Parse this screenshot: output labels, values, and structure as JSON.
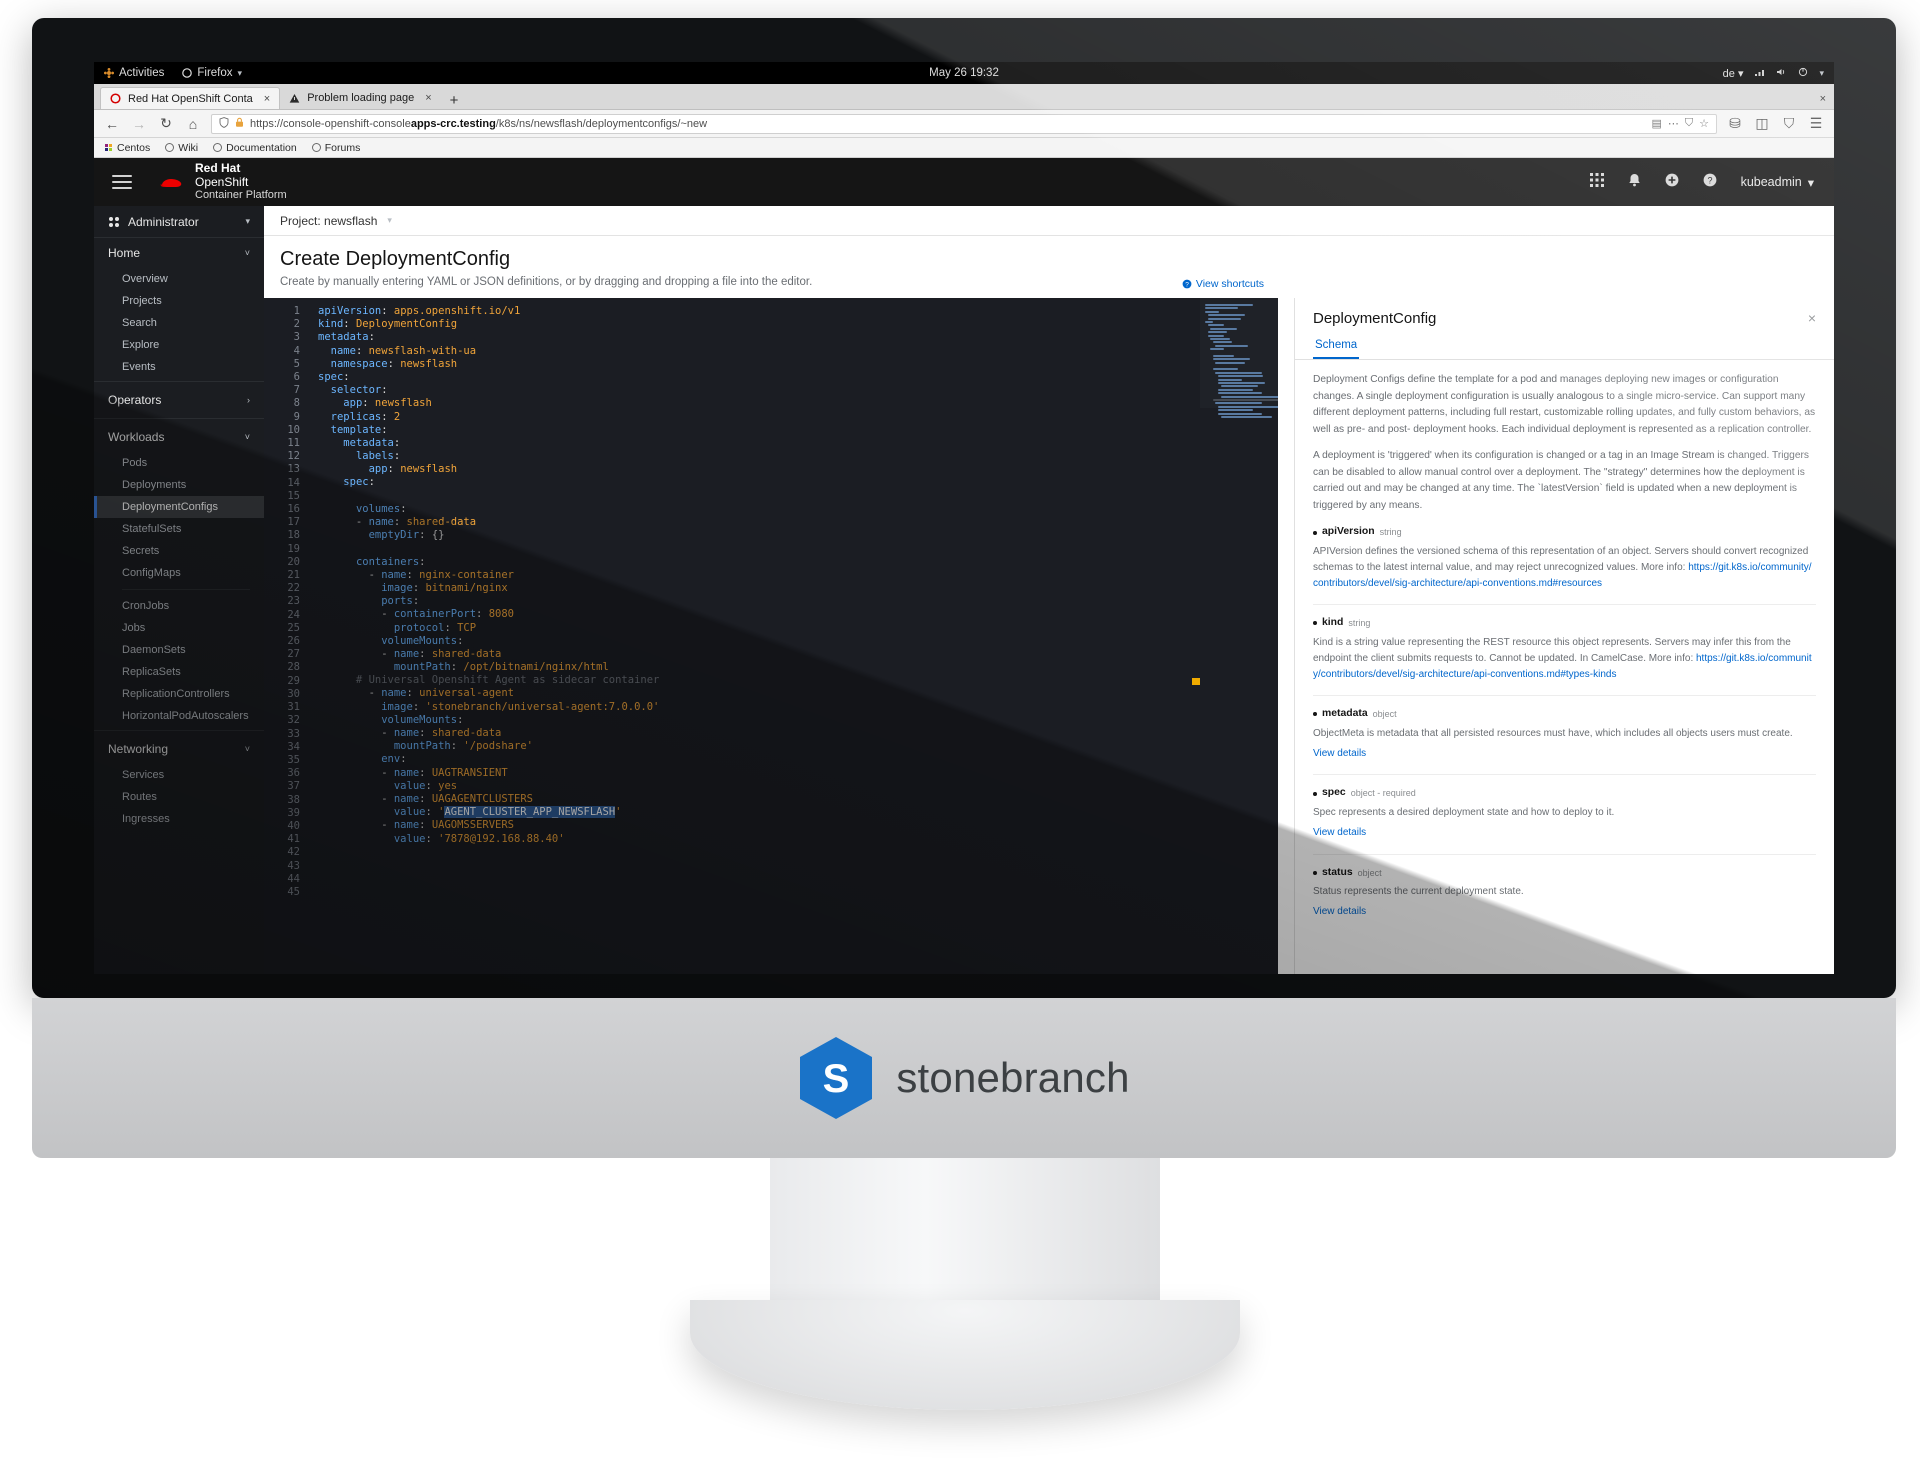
{
  "desktop": {
    "activities_label": "Activities",
    "app_menu_label": "Firefox",
    "clock": "May 26  19:32",
    "keyboard_layout": "de",
    "icons": [
      "network-icon",
      "volume-icon",
      "power-icon"
    ]
  },
  "browser": {
    "tabs": [
      {
        "title": "Red Hat OpenShift Conta",
        "favicon": "openshift-favicon",
        "active": true,
        "close": "×"
      },
      {
        "title": "Problem loading page",
        "favicon": "warning-icon",
        "active": false,
        "close": "×"
      }
    ],
    "new_tab_label": "+",
    "window_close": "×",
    "nav": {
      "back": "←",
      "forward": "→",
      "reload": "↻",
      "home": "⌂"
    },
    "url": {
      "scheme": "https://console-openshift-console",
      "host": "apps-crc.testing",
      "path": "/k8s/ns/newsflash/deploymentconfigs/~new",
      "shield_icon": "tracking-protection-icon",
      "lock_icon": "padlock-icon",
      "reader_icon": "reader-view-icon",
      "dots_icon": "page-actions-icon",
      "pocket_icon": "pocket-icon",
      "star_icon": "bookmark-star-icon"
    },
    "toolbar_right": [
      "library-icon",
      "sidebar-icon",
      "account-icon",
      "menu-icon"
    ],
    "bookmarks": [
      {
        "label": "Centos",
        "icon": "centos-favicon"
      },
      {
        "label": "Wiki",
        "icon": "globe-icon"
      },
      {
        "label": "Documentation",
        "icon": "globe-icon"
      },
      {
        "label": "Forums",
        "icon": "globe-icon"
      }
    ]
  },
  "masthead": {
    "brand_line1": "Red Hat",
    "brand_line2": "OpenShift",
    "brand_line3": "Container Platform",
    "icons": [
      "applications-grid-icon",
      "notification-bell-icon",
      "plus-circle-icon",
      "help-circle-icon"
    ],
    "user": "kubeadmin",
    "user_caret": "▾"
  },
  "sidebar": {
    "perspective": {
      "label": "Administrator",
      "icon": "perspective-icon",
      "caret": "▾"
    },
    "groups": [
      {
        "label": "Home",
        "caret": "˅",
        "expanded": true,
        "items": [
          {
            "label": "Overview",
            "active": false
          },
          {
            "label": "Projects",
            "active": false
          },
          {
            "label": "Search",
            "active": false
          },
          {
            "label": "Explore",
            "active": false
          },
          {
            "label": "Events",
            "active": false
          }
        ]
      },
      {
        "label": "Operators",
        "caret": "›",
        "expanded": false,
        "items": []
      },
      {
        "label": "Workloads",
        "caret": "˅",
        "expanded": true,
        "items": [
          {
            "label": "Pods",
            "active": false
          },
          {
            "label": "Deployments",
            "active": false
          },
          {
            "label": "DeploymentConfigs",
            "active": true
          },
          {
            "label": "StatefulSets",
            "active": false
          },
          {
            "label": "Secrets",
            "active": false
          },
          {
            "label": "ConfigMaps",
            "active": false
          },
          {
            "label": "__sep__",
            "active": false
          },
          {
            "label": "CronJobs",
            "active": false
          },
          {
            "label": "Jobs",
            "active": false
          },
          {
            "label": "DaemonSets",
            "active": false
          },
          {
            "label": "ReplicaSets",
            "active": false
          },
          {
            "label": "ReplicationControllers",
            "active": false
          },
          {
            "label": "HorizontalPodAutoscalers",
            "active": false
          }
        ]
      },
      {
        "label": "Networking",
        "caret": "˅",
        "expanded": true,
        "items": [
          {
            "label": "Services",
            "active": false
          },
          {
            "label": "Routes",
            "active": false
          },
          {
            "label": "Ingresses",
            "active": false
          }
        ]
      }
    ]
  },
  "main": {
    "project_label": "Project: newsflash",
    "project_caret": "▾",
    "title": "Create DeploymentConfig",
    "subtitle": "Create by manually entering YAML or JSON definitions, or by dragging and dropping a file into the editor.",
    "view_shortcuts": "View shortcuts",
    "shortcuts_icon": "question-circle-icon"
  },
  "editor": {
    "total_lines": 45,
    "lines": [
      {
        "n": 1,
        "text": "apiVersion: apps.openshift.io/v1"
      },
      {
        "n": 2,
        "text": "kind: DeploymentConfig"
      },
      {
        "n": 3,
        "text": "metadata:"
      },
      {
        "n": 4,
        "text": "  name: newsflash-with-ua"
      },
      {
        "n": 5,
        "text": "  namespace: newsflash"
      },
      {
        "n": 6,
        "text": "spec:"
      },
      {
        "n": 7,
        "text": "  selector:"
      },
      {
        "n": 8,
        "text": "    app: newsflash"
      },
      {
        "n": 9,
        "text": "  replicas: 2"
      },
      {
        "n": 10,
        "text": "  template:"
      },
      {
        "n": 11,
        "text": "    metadata:"
      },
      {
        "n": 12,
        "text": "      labels:"
      },
      {
        "n": 13,
        "text": "        app: newsflash"
      },
      {
        "n": 14,
        "text": "    spec:"
      },
      {
        "n": 15,
        "text": ""
      },
      {
        "n": 16,
        "text": "      volumes:"
      },
      {
        "n": 17,
        "text": "      - name: shared-data"
      },
      {
        "n": 18,
        "text": "        emptyDir: {}"
      },
      {
        "n": 19,
        "text": ""
      },
      {
        "n": 20,
        "text": "      containers:"
      },
      {
        "n": 21,
        "text": "        - name: nginx-container"
      },
      {
        "n": 22,
        "text": "          image: bitnami/nginx"
      },
      {
        "n": 23,
        "text": "          ports:"
      },
      {
        "n": 24,
        "text": "          - containerPort: 8080"
      },
      {
        "n": 25,
        "text": "            protocol: TCP"
      },
      {
        "n": 26,
        "text": "          volumeMounts:"
      },
      {
        "n": 27,
        "text": "          - name: shared-data"
      },
      {
        "n": 28,
        "text": "            mountPath: /opt/bitnami/nginx/html"
      },
      {
        "n": 29,
        "text": "      # Universal Openshift Agent as sidecar container"
      },
      {
        "n": 30,
        "text": "        - name: universal-agent"
      },
      {
        "n": 31,
        "text": "          image: 'stonebranch/universal-agent:7.0.0.0'"
      },
      {
        "n": 32,
        "text": "          volumeMounts:"
      },
      {
        "n": 33,
        "text": "          - name: shared-data"
      },
      {
        "n": 34,
        "text": "            mountPath: '/podshare'"
      },
      {
        "n": 35,
        "text": "          env:"
      },
      {
        "n": 36,
        "text": "          - name: UAGTRANSIENT"
      },
      {
        "n": 37,
        "text": "            value: yes"
      },
      {
        "n": 38,
        "text": "          - name: UAGAGENTCLUSTERS"
      },
      {
        "n": 39,
        "text": "            value: 'AGENT_CLUSTER_APP_NEWSFLASH'"
      },
      {
        "n": 40,
        "text": "          - name: UAGOMSSERVERS"
      },
      {
        "n": 41,
        "text": "            value: '7878@192.168.88.40'"
      },
      {
        "n": 42,
        "text": ""
      },
      {
        "n": 43,
        "text": ""
      },
      {
        "n": 44,
        "text": ""
      },
      {
        "n": 45,
        "text": ""
      }
    ],
    "selected_text": "AGENT_CLUSTER_APP_NEWSFLASH",
    "cursor_line": 39
  },
  "schema": {
    "title": "DeploymentConfig",
    "close_label": "×",
    "tabs": [
      {
        "label": "Schema",
        "active": true
      }
    ],
    "paragraphs": [
      "Deployment Configs define the template for a pod and manages deploying new images or configuration changes. A single deployment configuration is usually analogous to a single micro-service. Can support many different deployment patterns, including full restart, customizable rolling updates, and  fully custom behaviors, as well as pre- and post- deployment hooks. Each individual deployment is represented as a replication controller.",
      "A deployment is 'triggered' when its configuration is changed or a tag in an Image Stream is changed. Triggers can be disabled to allow manual control over a deployment. The \"strategy\" determines how the deployment is carried out and may be changed at any time. The `latestVersion` field is updated when a new deployment is triggered by any means."
    ],
    "properties": [
      {
        "name": "apiVersion",
        "type": "string",
        "desc": "APIVersion defines the versioned schema of this representation of an object. Servers should convert recognized schemas to the latest internal value, and may reject unrecognized values. More info:",
        "link": "https://git.k8s.io/community/contributors/devel/sig-architecture/api-conventions.md#resources",
        "details": ""
      },
      {
        "name": "kind",
        "type": "string",
        "desc": "Kind is a string value representing the REST resource this object represents. Servers may infer this from the endpoint the client submits requests to. Cannot be updated. In CamelCase. More info:",
        "link": "https://git.k8s.io/community/contributors/devel/sig-architecture/api-conventions.md#types-kinds",
        "details": ""
      },
      {
        "name": "metadata",
        "type": "object",
        "desc": "ObjectMeta is metadata that all persisted resources must have, which includes all objects users must create.",
        "link": "",
        "details": "View details"
      },
      {
        "name": "spec",
        "type": "object - required",
        "desc": "Spec represents a desired deployment state and how to deploy to it.",
        "link": "",
        "details": "View details"
      },
      {
        "name": "status",
        "type": "object",
        "desc": "Status represents the current deployment state.",
        "link": "",
        "details": "View details"
      }
    ]
  },
  "brand_footer": {
    "name": "stonebranch",
    "logo_letter": "S",
    "logo_color": "#1a73c8",
    "text_color": "#3c4043"
  },
  "colors": {
    "masthead_bg": "#151515",
    "sidebar_bg": "#1b1d21",
    "editor_bg": "#1b1d23",
    "accent_blue": "#0066cc",
    "active_nav": "#3d7bd9"
  }
}
